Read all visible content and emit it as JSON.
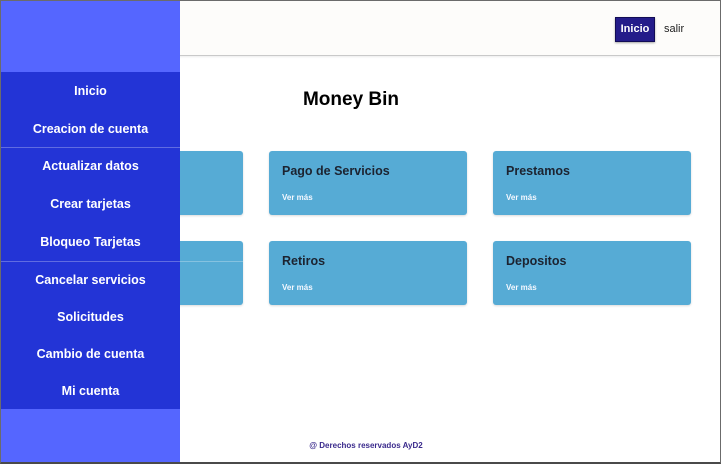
{
  "navbar": {
    "inicio_label": "Inicio",
    "salir_label": "salir"
  },
  "main": {
    "title": "Money Bin",
    "cards": [
      {
        "title": "Pago de Servicios",
        "link": "Ver más"
      },
      {
        "title": "Prestamos",
        "link": "Ver más"
      },
      {
        "title": "Retiros",
        "link": "Ver más"
      },
      {
        "title": "Depositos",
        "link": "Ver más"
      }
    ]
  },
  "sidebar": {
    "items": [
      {
        "label": "Inicio"
      },
      {
        "label": "Creacion de cuenta"
      },
      {
        "label": "Actualizar datos"
      },
      {
        "label": "Crear tarjetas"
      },
      {
        "label": "Bloqueo Tarjetas"
      },
      {
        "label": "Cancelar servicios"
      },
      {
        "label": "Solicitudes"
      },
      {
        "label": "Cambio de cuenta"
      },
      {
        "label": "Mi cuenta"
      }
    ]
  },
  "footer": {
    "text": "@ Derechos reservados AyD2"
  },
  "colors": {
    "sidebar_menu": "#2334d6",
    "sidebar_light": "#5566ff",
    "card": "#56abd5",
    "primary_button": "#241c8a"
  }
}
